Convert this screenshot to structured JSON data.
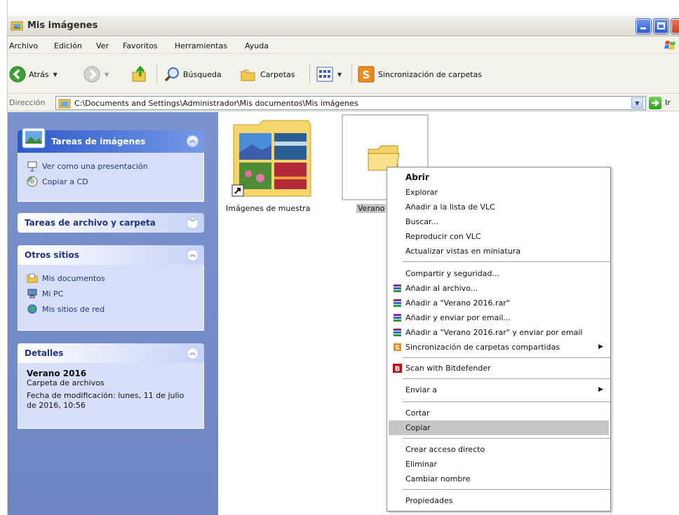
{
  "window": {
    "title": "Mis imágenes"
  },
  "menubar": {
    "items": [
      "Archivo",
      "Edición",
      "Ver",
      "Favoritos",
      "Herramientas",
      "Ayuda"
    ]
  },
  "toolbar": {
    "back": "Atrás",
    "search": "Búsqueda",
    "folders": "Carpetas",
    "sync": "Sincronización de carpetas"
  },
  "address": {
    "label": "Dirección",
    "path": "C:\\Documents and Settings\\Administrador\\Mis documentos\\Mis imágenes",
    "go": "Ir"
  },
  "left_panel": {
    "image_tasks": {
      "title": "Tareas de imágenes",
      "items": [
        "Ver como una presentación",
        "Copiar a CD"
      ]
    },
    "file_tasks": {
      "title": "Tareas de archivo y carpeta"
    },
    "other_places": {
      "title": "Otros sitios",
      "items": [
        "Mis documentos",
        "Mi PC",
        "Mis sitios de red"
      ]
    },
    "details": {
      "title": "Detalles",
      "name": "Verano 2016",
      "type": "Carpeta de archivos",
      "modified": "Fecha de modificación: lunes, 11 de julio de 2016, 10:56"
    }
  },
  "files": [
    {
      "name": "Imágenes de muestra"
    },
    {
      "name": "Verano"
    }
  ],
  "context_menu": {
    "items": [
      "Abrir",
      "Explorar",
      "Añadir a la lista de VLC",
      "Buscar...",
      "Reproducir con VLC",
      "Actualizar vistas en miniatura",
      "Compartir y seguridad...",
      "Añadir al archivo...",
      "Añadir a \"Verano 2016.rar\"",
      "Añadir y enviar por email...",
      "Añadir a \"Verano 2016.rar\" y enviar por email",
      "Sincronización de carpetas compartidas",
      "Scan with Bitdefender",
      "Enviar a",
      "Cortar",
      "Copiar",
      "Crear acceso directo",
      "Eliminar",
      "Cambiar nombre",
      "Propiedades"
    ],
    "highlighted": "Copiar"
  },
  "colors": {
    "taskpane": "#7c92cf",
    "highlight": "#c6c6c6",
    "title_text": "#215dc6"
  }
}
